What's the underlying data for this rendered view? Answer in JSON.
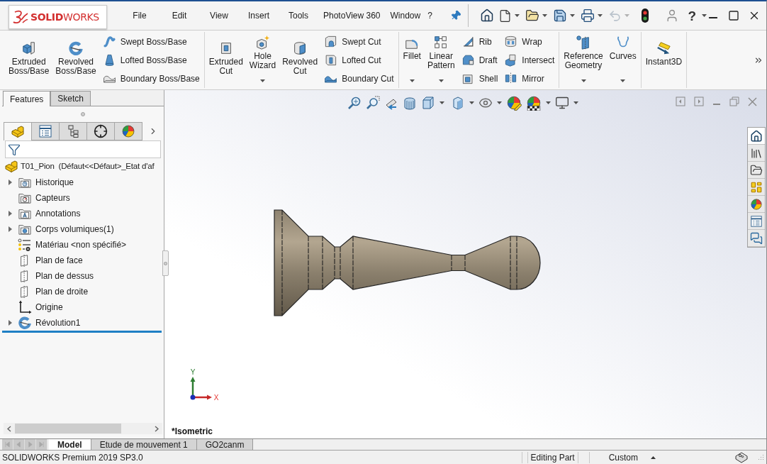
{
  "title_bar": {
    "logo": "**SOLID**WORKS",
    "menus": [
      "File",
      "Edit",
      "View",
      "Insert",
      "Tools",
      "PhotoView 360",
      "Window",
      "?"
    ]
  },
  "quick_access": {
    "undo": {
      "disabled": true
    },
    "help": "?"
  },
  "ribbon": {
    "groups": [
      {
        "tools": [
          {
            "kind": "large",
            "label": "Extruded Boss/Base",
            "dropdown": false
          },
          {
            "kind": "large",
            "label": "Revolved Boss/Base",
            "dropdown": false
          },
          {
            "kind": "small",
            "label": "Swept Boss/Base"
          },
          {
            "kind": "small",
            "label": "Lofted Boss/Base"
          },
          {
            "kind": "small",
            "label": "Boundary Boss/Base"
          }
        ]
      },
      {
        "tools": [
          {
            "kind": "large",
            "label": "Extruded Cut",
            "dropdown": false
          },
          {
            "kind": "large",
            "label": "Hole Wizard",
            "dropdown": true
          },
          {
            "kind": "large",
            "label": "Revolved Cut",
            "dropdown": false
          },
          {
            "kind": "small",
            "label": "Swept Cut"
          },
          {
            "kind": "small",
            "label": "Lofted Cut"
          },
          {
            "kind": "small",
            "label": "Boundary Cut"
          }
        ]
      },
      {
        "tools": [
          {
            "kind": "large",
            "label": "Fillet",
            "dropdown": true
          },
          {
            "kind": "large",
            "label": "Linear Pattern",
            "dropdown": true
          },
          {
            "kind": "small",
            "label": "Rib"
          },
          {
            "kind": "small",
            "label": "Draft"
          },
          {
            "kind": "small",
            "label": "Shell"
          },
          {
            "kind": "small",
            "label": "Wrap"
          },
          {
            "kind": "small",
            "label": "Intersect"
          },
          {
            "kind": "small",
            "label": "Mirror"
          }
        ]
      },
      {
        "tools": [
          {
            "kind": "large",
            "label": "Reference Geometry",
            "dropdown": true
          },
          {
            "kind": "large",
            "label": "Curves",
            "dropdown": true
          }
        ]
      },
      {
        "tools": [
          {
            "kind": "large",
            "label": "Instant3D",
            "dropdown": false
          }
        ]
      }
    ]
  },
  "command_tabs": [
    {
      "label": "Features",
      "selected": true
    },
    {
      "label": "Sketch",
      "selected": false
    }
  ],
  "feature_manager": {
    "tabs": [
      {
        "selected": true
      },
      {
        "selected": false
      },
      {
        "selected": false
      },
      {
        "selected": false
      },
      {
        "selected": false
      }
    ],
    "tree": {
      "label": "T01_Pion  (Défaut<<Défaut>_Etat d'af",
      "kind": "part",
      "children": [
        {
          "label": "Historique",
          "kind": "history",
          "expandable": true
        },
        {
          "label": "Capteurs",
          "kind": "sensors",
          "expandable": false
        },
        {
          "label": "Annotations",
          "kind": "annotations",
          "expandable": true
        },
        {
          "label": "Corps volumiques(1)",
          "kind": "solid_bodies",
          "expandable": true
        },
        {
          "label": "Matériau <non spécifié>",
          "kind": "material",
          "expandable": false
        },
        {
          "label": "Plan de face",
          "kind": "plane",
          "expandable": false
        },
        {
          "label": "Plan de dessus",
          "kind": "plane",
          "expandable": false
        },
        {
          "label": "Plan de droite",
          "kind": "plane",
          "expandable": false
        },
        {
          "label": "Origine",
          "kind": "origin",
          "expandable": false
        },
        {
          "label": "Révolution1",
          "kind": "revolve",
          "expandable": true
        }
      ]
    }
  },
  "graphics": {
    "task_pane": [
      {
        "selected": true
      },
      {
        "selected": false
      },
      {
        "selected": false
      },
      {
        "selected": false
      },
      {
        "selected": false
      },
      {
        "selected": false
      },
      {
        "selected": false
      }
    ],
    "triad": {
      "y": "Y",
      "x": "X"
    },
    "view_label": "*Isometric"
  },
  "document_tabs": [
    {
      "label": "Model",
      "selected": true
    },
    {
      "label": "Etude de mouvement 1",
      "selected": false
    },
    {
      "label": "GO2canm",
      "selected": false
    }
  ],
  "status_bar": {
    "product": "SOLIDWORKS Premium 2019 SP3.0",
    "mode": "Editing Part",
    "units": "Custom"
  }
}
